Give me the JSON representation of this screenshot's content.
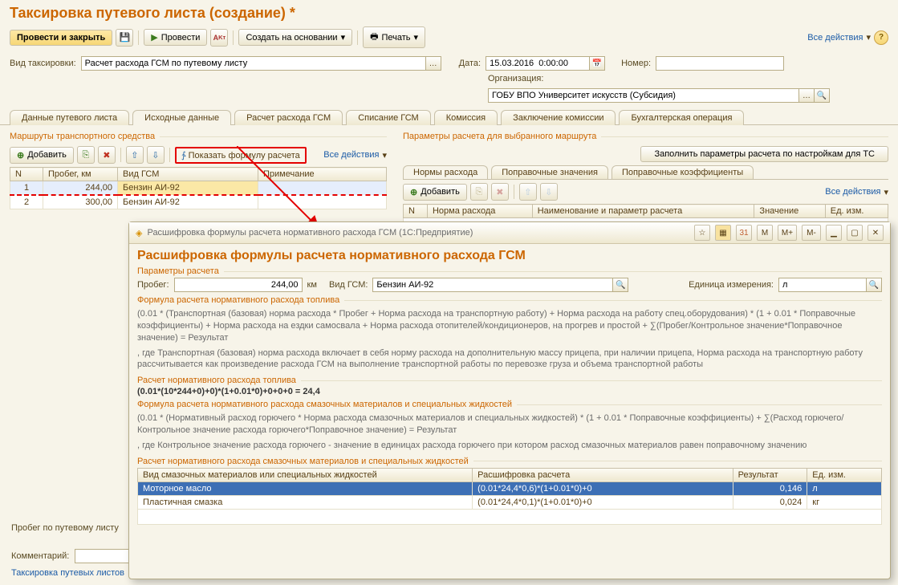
{
  "header": {
    "title": "Таксировка путевого листа (создание) *",
    "btn_close": "Провести и закрыть",
    "btn_post": "Провести",
    "btn_based_on": "Создать на основании",
    "btn_print": "Печать",
    "all_actions": "Все действия"
  },
  "filters": {
    "taks_label": "Вид таксировки:",
    "taks_value": "Расчет расхода ГСМ по путевому листу",
    "date_label": "Дата:",
    "date_value": "15.03.2016  0:00:00",
    "number_label": "Номер:",
    "number_value": "",
    "org_label": "Организация:",
    "org_value": "ГОБУ ВПО Университет искусств (Субсидия)"
  },
  "main_tabs": [
    "Данные путевого листа",
    "Исходные данные",
    "Расчет расхода ГСМ",
    "Списание ГСМ",
    "Комиссия",
    "Заключение комиссии",
    "Бухгалтерская операция"
  ],
  "main_tabs_active": 1,
  "left_group": "Маршруты транспортного средства",
  "right_group": "Параметры расчета для выбранного маршрута",
  "left_toolbar": {
    "add": "Добавить",
    "show_formula": "Показать формулу расчета",
    "all_actions": "Все действия"
  },
  "routes": {
    "columns": [
      "N",
      "Пробег, км",
      "Вид ГСМ",
      "Примечание"
    ],
    "rows": [
      {
        "n": "1",
        "mileage": "244,00",
        "fuel": "Бензин АИ-92",
        "note": ""
      },
      {
        "n": "2",
        "mileage": "300,00",
        "fuel": "Бензин АИ-92",
        "note": ""
      }
    ]
  },
  "right_panel": {
    "fill_btn": "Заполнить параметры расчета по настройкам для ТС",
    "inner_tabs": [
      "Нормы расхода",
      "Поправочные значения",
      "Поправочные коэффициенты"
    ],
    "add": "Добавить",
    "all_actions": "Все действия",
    "columns": [
      "N",
      "Норма расхода",
      "Наименование и параметр расчета",
      "Значение",
      "Ед. изм."
    ]
  },
  "footer": {
    "mileage_label": "Пробег по путевому листу",
    "comment_label": "Комментарий:",
    "taks_link": "Таксировка путевых листов"
  },
  "popup": {
    "window_title": "Расшифровка формулы расчета нормативного расхода ГСМ  (1С:Предприятие)",
    "h1": "Расшифровка формулы расчета нормативного расхода ГСМ",
    "params_title": "Параметры расчета",
    "mileage_label": "Пробег:",
    "mileage_value": "244,00",
    "mileage_unit": "км",
    "fuel_label": "Вид ГСМ:",
    "fuel_value": "Бензин АИ-92",
    "unit_label": "Единица измерения:",
    "unit_value": "л",
    "formula_fuel_title": "Формула расчета нормативного расхода топлива",
    "formula_fuel_text": "(0.01 * (Транспортная (базовая) норма расхода * Пробег  +  Норма расхода на транспортную работу) + Норма расхода на работу спец.оборудования) * (1 + 0.01 * Поправочные коэффициенты) + Норма расхода на ездки самосвала + Норма расхода отопителей/кондиционеров, на прогрев и простой + ∑(Пробег/Контрольное значение*Поправочное значение) = Результат",
    "formula_fuel_note": ", где Транспортная (базовая) норма расхода включает в себя норму расхода на дополнительную массу прицепа, при наличии прицепа, Норма расхода на транспортную работу рассчитывается как произведение расхода ГСМ на выполнение транспортной работы по перевозке груза и объема транспортной работы",
    "calc_fuel_title": "Расчет нормативного расхода топлива",
    "calc_fuel_value": "(0.01*(10*244+0)+0)*(1+0.01*0)+0+0+0 = 24,4",
    "formula_lub_title": "Формула расчета нормативного расхода смазочных материалов и специальных жидкостей",
    "formula_lub_text": "(0.01 * (Нормативный расход горючего * Норма расхода смазочных материалов и специальных жидкостей) * (1 + 0.01 * Поправочные коэффициенты) + ∑(Расход горючего/Контрольное значение расхода горючего*Поправочное значение) = Результат",
    "formula_lub_note": ", где Контрольное значение расхода горючего - значение в единицах расхода горючего при котором расход смазочных материалов равен поправочному значению",
    "calc_lub_title": "Расчет нормативного расхода смазочных материалов и специальных жидкостей",
    "lub_columns": [
      "Вид смазочных материалов или специальных жидкостей",
      "Расшифровка расчета",
      "Результат",
      "Ед. изм."
    ],
    "lub_rows": [
      {
        "name": "Моторное масло",
        "calc": "(0.01*24,4*0,6)*(1+0.01*0)+0",
        "result": "0,146",
        "unit": "л"
      },
      {
        "name": "Пластичная смазка",
        "calc": "(0.01*24,4*0,1)*(1+0.01*0)+0",
        "result": "0,024",
        "unit": "кг"
      }
    ],
    "tb_buttons": [
      "M",
      "M+",
      "M-"
    ]
  }
}
